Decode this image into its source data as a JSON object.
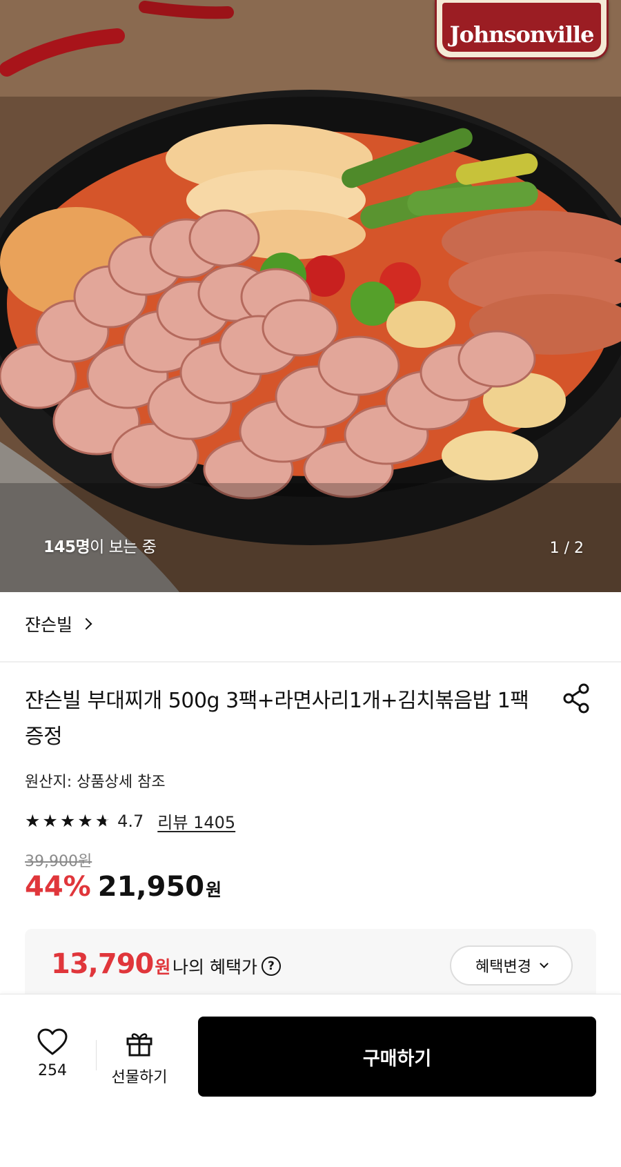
{
  "hero": {
    "brand_logo_text": "Johnsonville",
    "viewers_count": "145명",
    "viewers_suffix": "이 보는 중",
    "pager": "1 / 2"
  },
  "brand": {
    "name": "쟌슨빌"
  },
  "product": {
    "title": "쟌슨빌 부대찌개 500g 3팩+라면사리1개+김치볶음밥 1팩 증정",
    "origin": "원산지: 상품상세 참조",
    "rating_value": "4.7",
    "rating_stars": 4.7,
    "review_label": "리뷰 1405",
    "original_price": "39,900원",
    "discount": "44%",
    "sale_price": "21,950",
    "currency": "원"
  },
  "benefit": {
    "price": "13,790",
    "currency": "원",
    "label": "나의 혜택가",
    "help_icon": "?",
    "change_button": "혜택변경"
  },
  "bottom_bar": {
    "like_count": "254",
    "gift_label": "선물하기",
    "buy_label": "구매하기"
  },
  "colors": {
    "accent_red": "#e0363b",
    "buy_button": "#000000"
  }
}
